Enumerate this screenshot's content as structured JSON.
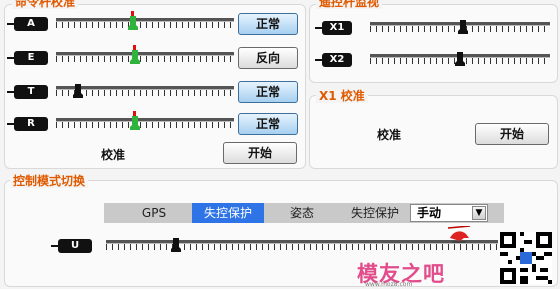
{
  "stick_panel": {
    "title": "命令杆校准",
    "channels": [
      {
        "id": "A",
        "status": "正常",
        "status_style": "blue",
        "level": 0.43,
        "mark": true
      },
      {
        "id": "E",
        "status": "反向",
        "status_style": "grey",
        "level": 0.44,
        "mark": true
      },
      {
        "id": "T",
        "status": "正常",
        "status_style": "blue",
        "level": 0.1,
        "mark": false
      },
      {
        "id": "R",
        "status": "正常",
        "status_style": "blue",
        "level": 0.44,
        "mark": true
      }
    ],
    "calibrate_label": "校准",
    "start_button": "开始"
  },
  "monitor_panel": {
    "title": "遥控杆监视",
    "channels": [
      {
        "id": "X1",
        "level": 0.52
      },
      {
        "id": "X2",
        "level": 0.5
      }
    ]
  },
  "x1_panel": {
    "title": "X1 校准",
    "calibrate_label": "校准",
    "start_button": "开始"
  },
  "mode_panel": {
    "title": "控制模式切换",
    "modes": [
      "GPS",
      "失控保护",
      "姿态",
      "失控保护"
    ],
    "active_mode": "失控保护",
    "select_value": "手动",
    "u_label": "U",
    "u_level": 0.17
  },
  "watermark": {
    "text": "模友之吧",
    "url": "www.moz8.com"
  },
  "colors": {
    "thumb_active": "#2fb33c",
    "thumb_dark": "#111111",
    "mark": "#e01010",
    "accent": "#e05a00",
    "active_tab": "#2f74e6"
  }
}
